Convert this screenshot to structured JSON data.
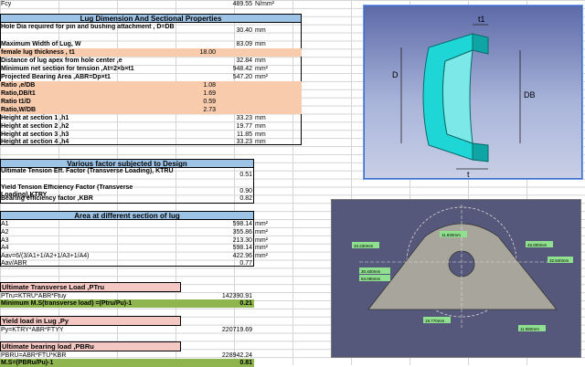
{
  "top": {
    "label": "Fcy",
    "value": "489.55",
    "unit": "N/mm²"
  },
  "section1": {
    "header": "Lug Dimension And Sectional Properties",
    "rows": [
      {
        "label": "Hole Dia required for pin and bushing attachment , D=DB",
        "value": "30.40",
        "unit": "mm"
      },
      {
        "label": "Maximum Width of Lug, W",
        "value": "83.09",
        "unit": "mm"
      },
      {
        "label": "female lug thickness ,  t1",
        "value": "18.00",
        "unit": ""
      },
      {
        "label": "Distance of lug apex from hole center ,e",
        "value": "32.84",
        "unit": "mm"
      },
      {
        "label": "Minimum net section for tension ,At=2×b×t1",
        "value": "948.42",
        "unit": "mm²"
      },
      {
        "label": "Projected Bearing Area ,ABR=Dp×t1",
        "value": "547.20",
        "unit": "mm²"
      },
      {
        "label": "Ratio ,e/DB",
        "value": "1.08",
        "unit": ""
      },
      {
        "label": "Ratio,DB/t1",
        "value": "1.69",
        "unit": ""
      },
      {
        "label": "Ratio t1/D",
        "value": "0.59",
        "unit": ""
      },
      {
        "label": "Ratio,W/DB",
        "value": "2.73",
        "unit": ""
      },
      {
        "label": "Height at section 1 ,h1",
        "value": "33.23",
        "unit": "mm"
      },
      {
        "label": "Height at section 2 ,h2",
        "value": "19.77",
        "unit": "mm"
      },
      {
        "label": "Height at section 3 ,h3",
        "value": "11.85",
        "unit": "mm"
      },
      {
        "label": "Height at section 4 ,h4",
        "value": "33.23",
        "unit": "mm"
      }
    ]
  },
  "section2": {
    "header": "Various factor subjected to Design",
    "rows": [
      {
        "label": "Ultimate Tension Eff. Factor (Transverse Loading), KTRU",
        "value": "0.51"
      },
      {
        "label": "Yield Tension Efficiency Factor (Transverse Loading),KTRY",
        "value": "0.90"
      },
      {
        "label": "Bearing efficiency factor ,KBR",
        "value": "0.82"
      }
    ]
  },
  "section3": {
    "header": "Area at different section of lug",
    "rows": [
      {
        "label": "A1",
        "value": "598.14",
        "unit": "mm²"
      },
      {
        "label": "A2",
        "value": "355.86",
        "unit": "mm²"
      },
      {
        "label": "A3",
        "value": "213.30",
        "unit": "mm²"
      },
      {
        "label": "A4",
        "value": "598.14",
        "unit": "mm²"
      },
      {
        "label": "Aav=6/(3/A1+1/A2+1/A3+1/A4)",
        "value": "422.96",
        "unit": "mm²"
      },
      {
        "label": "Aav/ABR",
        "value": "0.77",
        "unit": ""
      }
    ]
  },
  "section4": {
    "header": "Ultimate Transverse Load ,PTru",
    "formula": "PTru=KTRU*ABR*Ftuy",
    "value": "142390.91",
    "ms_label": "Minimum M.S(transverse load) =(Ptru/Pu)-1",
    "ms_value": "0.21"
  },
  "section5": {
    "header": "Yield load in Lug ,Py",
    "formula": "Py=KTRY*ABR*FTYY",
    "value": "220719.69"
  },
  "section6": {
    "header": "Ultimate bearing load ,PBRu",
    "formula": "PBRU=ABR*FTU*KBR",
    "value": "228942.24",
    "ms_label": "M.S=(PBRu/Pu)-1",
    "ms_value": "0.81"
  },
  "diagram3d": {
    "labels": {
      "t": "t",
      "t1": "t1",
      "D": "D",
      "DB": "DB"
    }
  },
  "diagram2d": {
    "labels": [
      "11.830mm",
      "45.000mm",
      "33.230mm",
      "30.400mm",
      "83.090mm",
      "32.840mm",
      "19.770mm",
      "11.850mm"
    ]
  },
  "colors": {
    "header": "#9dc3e6",
    "orange": "#f8cbad",
    "green": "#8fb64e",
    "pink": "#f4c7c3"
  }
}
